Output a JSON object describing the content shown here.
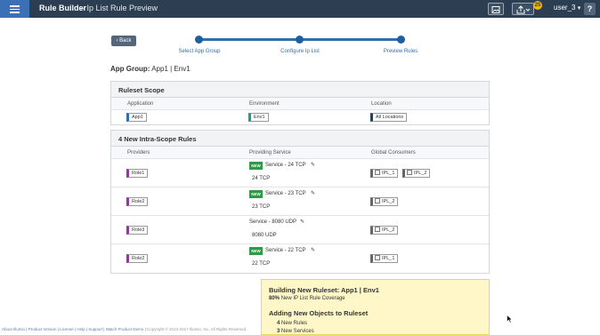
{
  "header": {
    "title": "Rule Builder",
    "subtitle": "–  Ip List Rule Preview",
    "notification_count": "25",
    "user": "user_3",
    "help": "?"
  },
  "back_label": "Back",
  "stepper": {
    "steps": [
      "Select App Group",
      "Configure Ip List",
      "Preview Rules"
    ]
  },
  "app_group": {
    "label": "App Group:",
    "value": "App1 | Env1"
  },
  "scope": {
    "title": "Ruleset Scope",
    "columns": [
      "Application",
      "Environment",
      "Location"
    ],
    "row": {
      "application": "App1",
      "environment": "Env1",
      "location": "All Locations"
    }
  },
  "rules": {
    "title": "4 New Intra-Scope Rules",
    "columns": [
      "Providers",
      "Providing Service",
      "Global Consumers"
    ],
    "new_label": "NEW",
    "rows": [
      {
        "provider": "Role1",
        "service": "Service - 24 TCP",
        "port": "24 TCP",
        "consumers": [
          "IPL_1",
          "IPL_2"
        ]
      },
      {
        "provider": "Role2",
        "service": "Service - 23 TCP",
        "port": "23 TCP",
        "consumers": [
          "IPL_2"
        ]
      },
      {
        "provider": "Role3",
        "service": "Service - 8080 UDP",
        "port": "8080 UDP",
        "consumers": [
          "IPL_2"
        ]
      },
      {
        "provider": "Role2",
        "service": "Service - 22 TCP",
        "port": "22 TCP",
        "consumers": [
          "IPL_1"
        ]
      }
    ]
  },
  "summary": {
    "title": "Building New Ruleset: App1 | Env1",
    "coverage_pct": "80%",
    "coverage_text": "New IP List Rule Coverage",
    "add_title": "Adding New Objects to Ruleset",
    "new_rules_count": "4",
    "new_rules_label": "New Rules",
    "new_services_count": "3",
    "new_services_label": "New Services"
  },
  "footer": {
    "links": [
      "About Illumio",
      "Product Version",
      "License",
      "Help",
      "Support",
      "Watch Product Demo"
    ],
    "copyright": "Copyright © 2013-2017 Illumio, Inc. All Rights Reserved."
  },
  "icons": {
    "menu": "hamburger-icon",
    "image": "image-icon",
    "export": "export-icon",
    "edit": "pencil-icon",
    "iplist": "ip-list-icon",
    "cursor": "mouse-pointer-icon"
  },
  "colors": {
    "topbar": "#2c3e51",
    "menu_button": "#3b6fb6",
    "stepper": "#2f6fad",
    "new_badge": "#2d9b45",
    "summary_bg": "#fff7c8",
    "role_accent": "#8a3e8f",
    "env_accent": "#1a9b8e"
  }
}
